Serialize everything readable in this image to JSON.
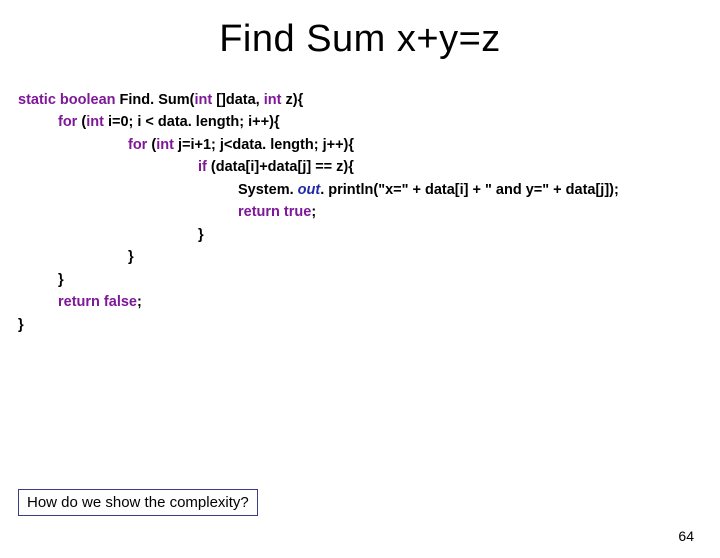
{
  "title": "Find Sum x+y=z",
  "code": {
    "l1_kw": "static boolean ",
    "l1_rest": "Find. Sum(",
    "l1_kw2": "int ",
    "l1_rest2": "[]data, ",
    "l1_kw3": "int ",
    "l1_rest3": "z){",
    "l2_kw": "for ",
    "l2_rest": "(",
    "l2_kw2": "int ",
    "l2_rest2": "i=0; i < data. length; i++){",
    "l3_kw": "for ",
    "l3_rest": "(",
    "l3_kw2": "int ",
    "l3_rest2": "j=i+1; j<data. length; j++){",
    "l4_kw": "if ",
    "l4_rest": "(data[i]+data[j] == z){",
    "l5a": "System. ",
    "l5out": "out",
    "l5b": ". println(\"x=\" + data[i] + \" and y=\" + data[j]);",
    "l6_kw": "return true",
    "l6_rest": ";",
    "l7": "}",
    "l8": "}",
    "l9": "}",
    "l10_kw": "return false",
    "l10_rest": ";",
    "l11": "}"
  },
  "footer": "How do we show the complexity?",
  "page": "64"
}
